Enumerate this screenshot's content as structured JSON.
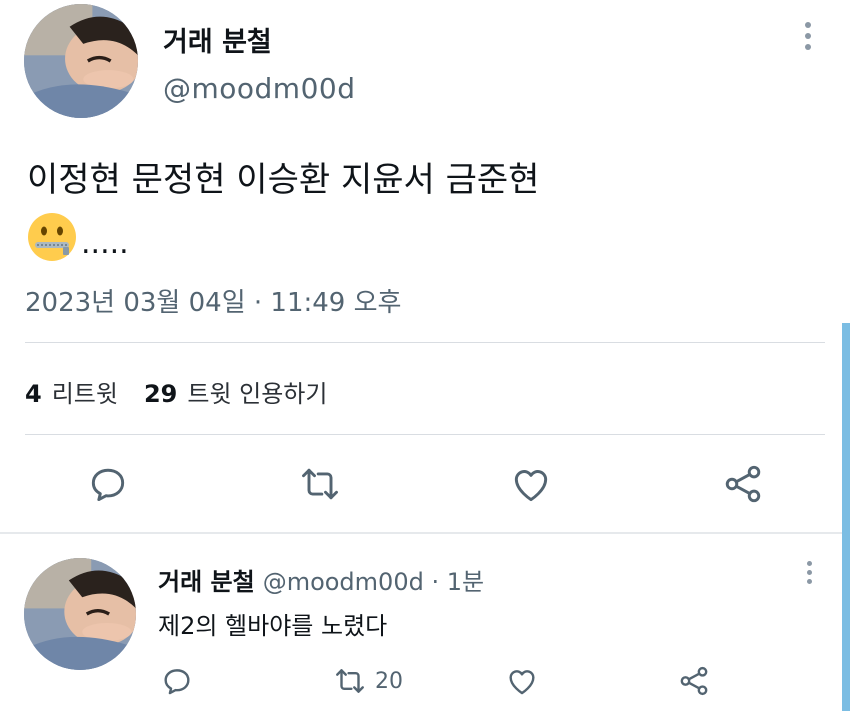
{
  "tweet": {
    "author_name": "거래 분철",
    "author_handle": "@moodm00d",
    "text": "이정현 문정현 이승환 지윤서 금준현",
    "emoji_icon": "zipper-mouth-face",
    "trailing_text": ".....",
    "timestamp": "2023년 03월 04일 · 11:49 오후"
  },
  "stats": {
    "retweets_count": "4",
    "retweets_label": "리트윗",
    "quotes_count": "29",
    "quotes_label": "트윗 인용하기"
  },
  "actions": [
    "reply-icon",
    "retweet-icon",
    "like-icon",
    "share-icon"
  ],
  "reply": {
    "author_name": "거래 분철",
    "meta": "@moodm00d · 1분",
    "text": "제2의 헬바야를 노렸다",
    "retweet_count": "20"
  },
  "colors": {
    "secondary_text": "#536471",
    "icon_color": "#536471",
    "scrollbar": "#7bbde3"
  }
}
